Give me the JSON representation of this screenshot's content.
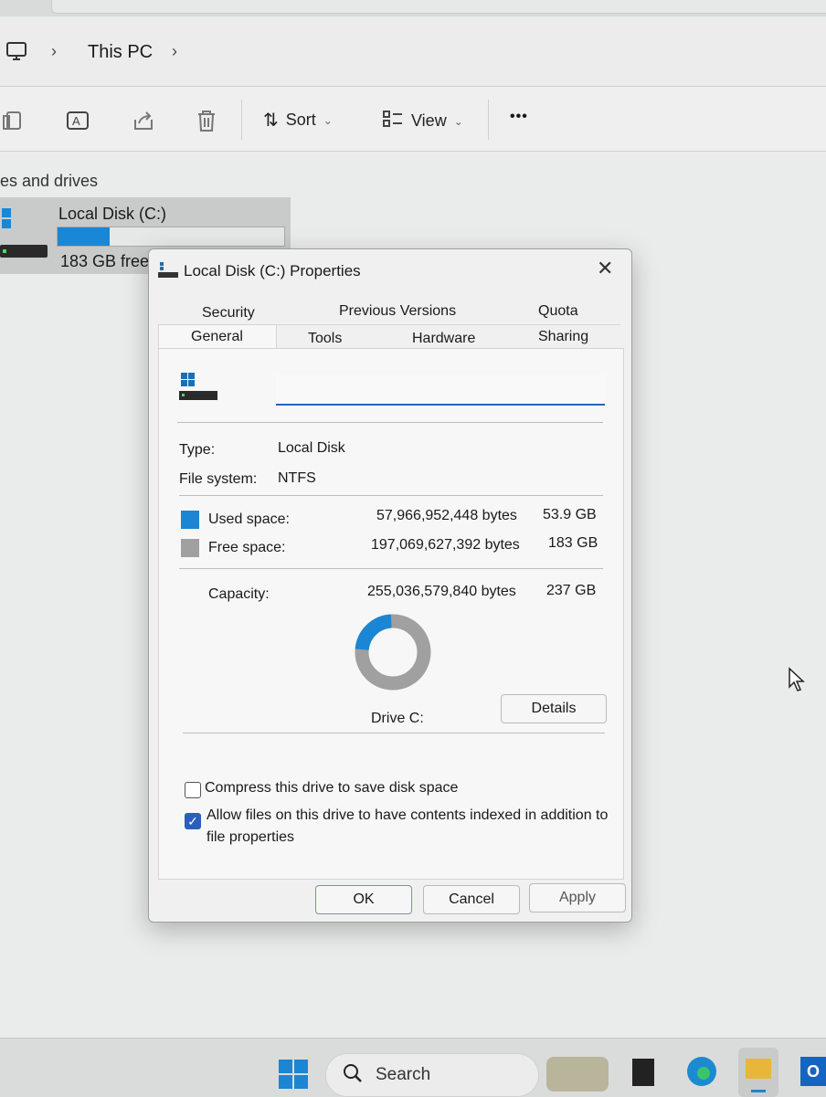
{
  "explorer": {
    "breadcrumb": "This PC",
    "sort_label": "Sort",
    "view_label": "View",
    "more_label": "•••",
    "section_header": "es and drives",
    "drive": {
      "name": "Local Disk (C:)",
      "free_text": "183 GB free",
      "used_fraction": 0.23
    }
  },
  "dialog": {
    "title": "Local Disk (C:) Properties",
    "close_glyph": "✕",
    "tabs_row1": [
      "Security",
      "Previous Versions",
      "Quota"
    ],
    "tabs_row2": [
      "General",
      "Tools",
      "Hardware",
      "Sharing"
    ],
    "active_tab": "General",
    "name_value": "",
    "type_label": "Type:",
    "type_value": "Local Disk",
    "fs_label": "File system:",
    "fs_value": "NTFS",
    "used_label": "Used space:",
    "used_bytes": "57,966,952,448 bytes",
    "used_gb": "53.9 GB",
    "free_label": "Free space:",
    "free_bytes": "197,069,627,392 bytes",
    "free_gb": "183 GB",
    "capacity_label": "Capacity:",
    "capacity_bytes": "255,036,579,840 bytes",
    "capacity_gb": "237 GB",
    "drive_label": "Drive C:",
    "details_button": "Details",
    "compress_label": "Compress this drive to save disk space",
    "compress_checked": false,
    "index_label": "Allow files on this drive to have contents indexed in addition to",
    "index_label_2": "file properties",
    "index_checked": true,
    "ok_button": "OK",
    "cancel_button": "Cancel",
    "apply_button": "Apply",
    "used_color": "#1a86d4",
    "free_color": "#a0a0a0",
    "used_fraction": 0.227
  },
  "taskbar": {
    "search_label": "Search"
  }
}
